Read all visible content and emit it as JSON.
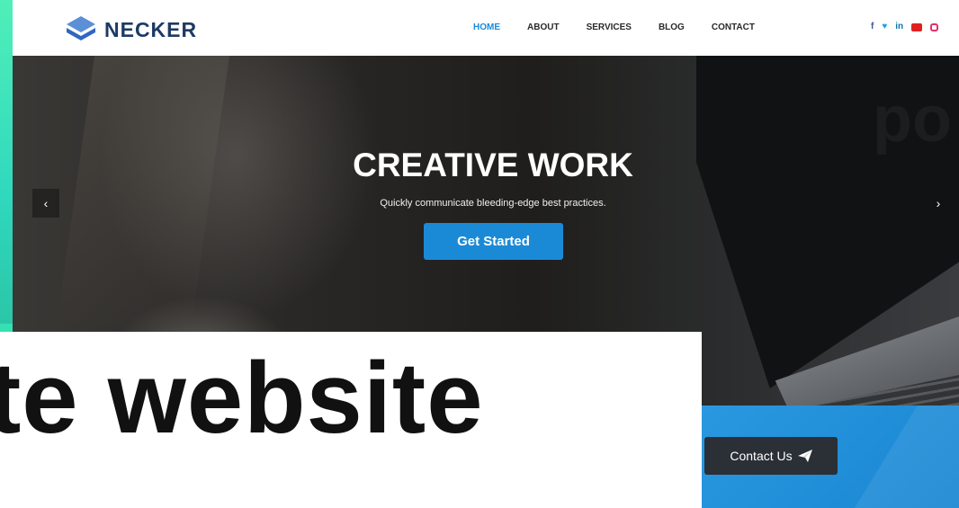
{
  "navbar": {
    "brand": "NECKER",
    "links": [
      {
        "label": "HOME",
        "active": true
      },
      {
        "label": "ABOUT"
      },
      {
        "label": "SERVICES"
      },
      {
        "label": "BLOG"
      },
      {
        "label": "CONTACT"
      }
    ],
    "social_icons": [
      "facebook-icon",
      "twitter-icon",
      "linkedin-icon",
      "youtube-icon",
      "instagram-icon"
    ],
    "social": {
      "fb": "f",
      "tw": "♥",
      "li": "in"
    }
  },
  "hero": {
    "title": "CREATIVE WORK",
    "subtitle": "Quickly communicate bleeding-edge best practices.",
    "cta_label": "Get Started",
    "prev_arrow": "‹",
    "next_arrow": "›"
  },
  "overlay": {
    "text": "te website"
  },
  "contact": {
    "label": "Contact Us",
    "icon": "paper-plane-icon"
  },
  "colors": {
    "accent": "#1b8ad6",
    "brand": "#1e3a63",
    "mint": "#35e0b2",
    "dark_button": "#2b2f36"
  }
}
